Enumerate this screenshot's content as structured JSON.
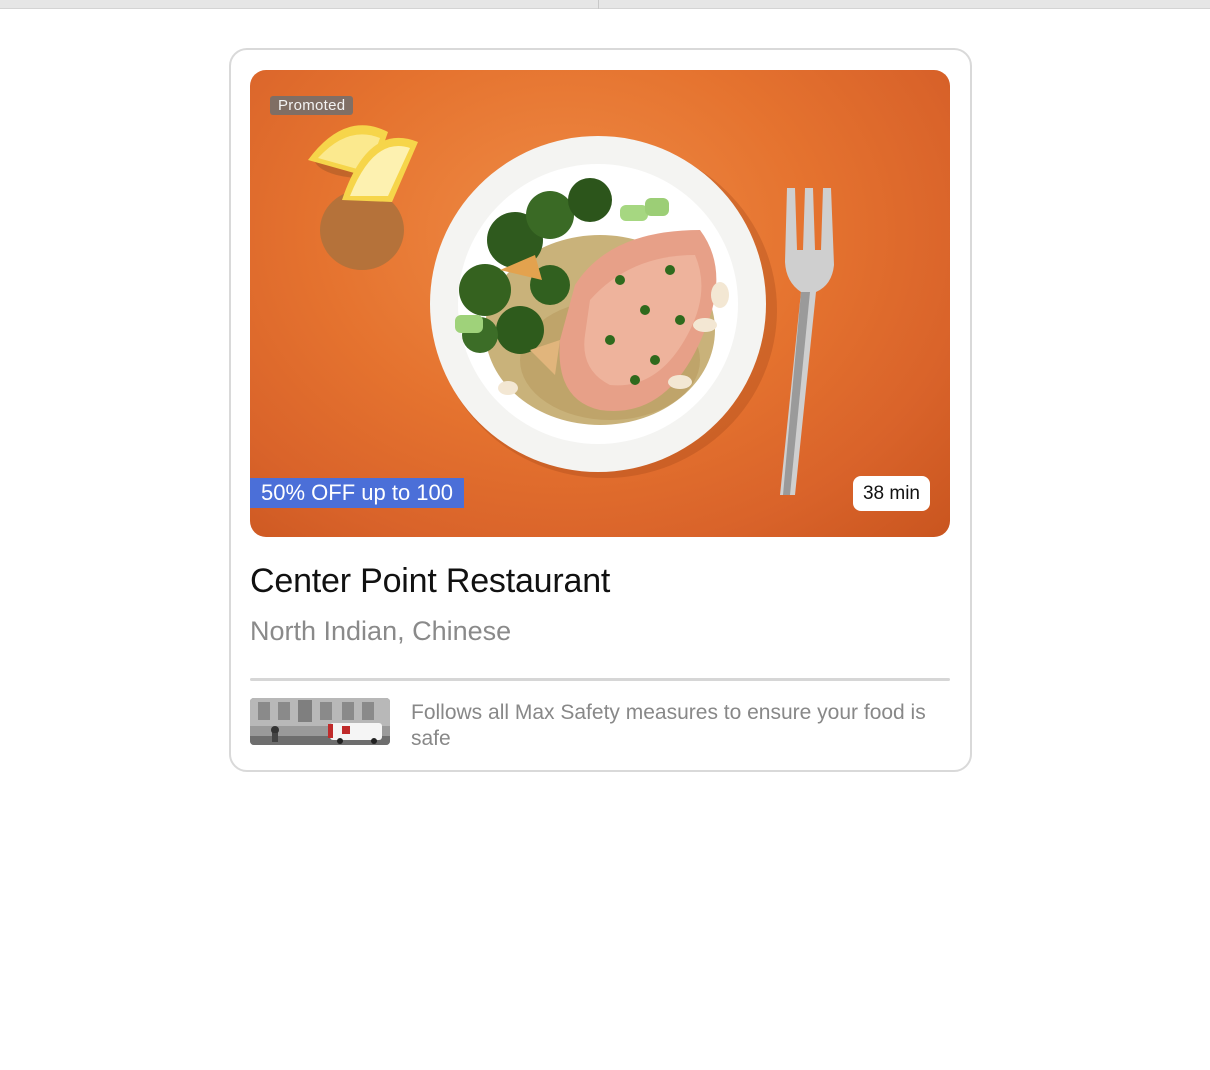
{
  "card": {
    "badge": "Promoted",
    "offer": "50% OFF up to 100",
    "delivery_time": "38 min",
    "restaurant_name": "Center Point Restaurant",
    "cuisines": "North Indian, Chinese",
    "safety_message": "Follows all Max Safety measures to ensure your food is safe"
  },
  "colors": {
    "offer_bg": "#4b6fd8",
    "hero_bg": "#e5732f",
    "muted_text": "#8a8a8a"
  }
}
